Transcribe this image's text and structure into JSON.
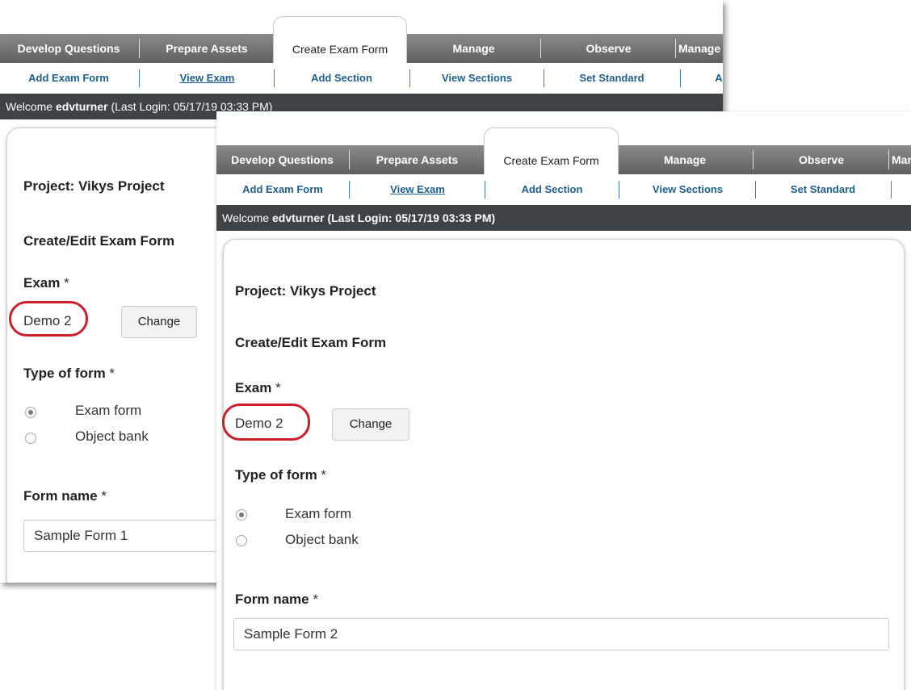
{
  "nav": {
    "tabs": [
      "Develop Questions",
      "Prepare Assets",
      "Create Exam Form",
      "Manage",
      "Observe",
      "Manage"
    ],
    "active_tab": "Create Exam Form"
  },
  "subnav": {
    "items": [
      "Add Exam Form",
      "View Exam",
      "Add Section",
      "View Sections",
      "Set Standard",
      "A"
    ]
  },
  "welcome": {
    "prefix": "Welcome",
    "user": "edvturner",
    "last_login_front": "(Last Login: 05/17/19    03:33 PM)",
    "last_login_back": "(Last Login: 05/17/19    03:33 PM)"
  },
  "form": {
    "project_label": "Project: Vikys Project",
    "title": "Create/Edit Exam Form",
    "exam_label": "Exam",
    "required_mark": "*",
    "exam_value": "Demo 2",
    "change_button": "Change",
    "type_label": "Type of form",
    "type_options": [
      "Exam form",
      "Object bank"
    ],
    "type_selected": "Exam form",
    "form_name_label": "Form name",
    "form_name_back": "Sample Form 1",
    "form_name_front": "Sample Form 2"
  },
  "colors": {
    "nav_bg": "#6e6e6e",
    "subnav_link": "#1f5f8b",
    "welcome_bg": "#3d4347",
    "highlight_circle": "#cc1f2b"
  }
}
